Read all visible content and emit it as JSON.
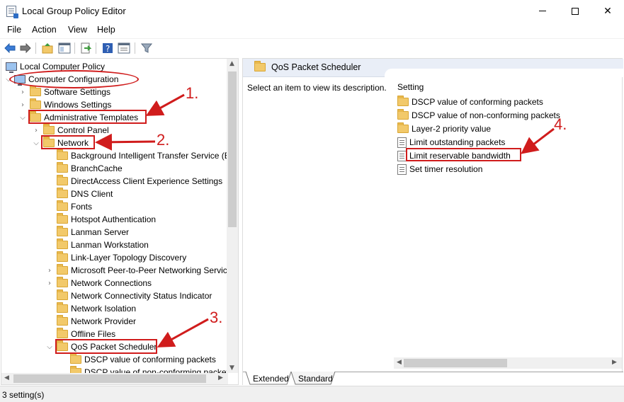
{
  "window": {
    "title": "Local Group Policy Editor"
  },
  "menu": [
    "File",
    "Action",
    "View",
    "Help"
  ],
  "toolbar": [
    "back-arrow-icon",
    "forward-arrow-icon",
    "up-folder-icon",
    "show-hide-tree-icon",
    "export-list-icon",
    "help-icon",
    "properties-icon",
    "filter-icon"
  ],
  "tree": {
    "root": "Local Computer Policy",
    "computer_config": "Computer Configuration",
    "software_settings": "Software Settings",
    "windows_settings": "Windows Settings",
    "admin_templates": "Administrative Templates",
    "control_panel": "Control Panel",
    "network": "Network",
    "network_children": [
      "Background Intelligent Transfer Service (B",
      "BranchCache",
      "DirectAccess Client Experience Settings",
      "DNS Client",
      "Fonts",
      "Hotspot Authentication",
      "Lanman Server",
      "Lanman Workstation",
      "Link-Layer Topology Discovery",
      "Microsoft Peer-to-Peer Networking Servic",
      "Network Connections",
      "Network Connectivity Status Indicator",
      "Network Isolation",
      "Network Provider",
      "Offline Files",
      "QoS Packet Scheduler"
    ],
    "qos_children": [
      "DSCP value of conforming packets",
      "DSCP value of non-conforming packets"
    ]
  },
  "right": {
    "title": "QoS Packet Scheduler",
    "description": "Select an item to view its description.",
    "column_header": "Setting",
    "settings": [
      {
        "label": "DSCP value of conforming packets",
        "kind": "folder"
      },
      {
        "label": "DSCP value of non-conforming packets",
        "kind": "folder"
      },
      {
        "label": "Layer-2 priority value",
        "kind": "folder"
      },
      {
        "label": "Limit outstanding packets",
        "kind": "policy"
      },
      {
        "label": "Limit reservable bandwidth",
        "kind": "policy"
      },
      {
        "label": "Set timer resolution",
        "kind": "policy"
      }
    ],
    "tabs": [
      "Extended",
      "Standard"
    ]
  },
  "status": "3 setting(s)",
  "annotations": [
    "1.",
    "2.",
    "3.",
    "4."
  ],
  "colors": {
    "annotation": "#d01c1c",
    "folder": "#f2c96a",
    "header": "#e9eef7"
  }
}
